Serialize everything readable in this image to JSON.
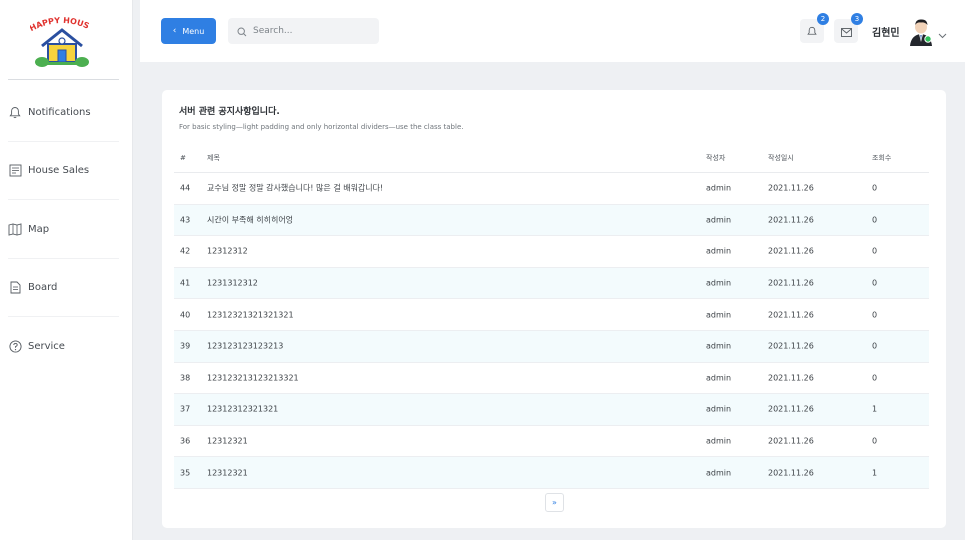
{
  "logo": {
    "text": "HAPPY HOUSE"
  },
  "sidebar": {
    "items": [
      {
        "label": "Notifications",
        "icon": "bell-icon"
      },
      {
        "label": "House Sales",
        "icon": "receipt-icon"
      },
      {
        "label": "Map",
        "icon": "map-icon"
      },
      {
        "label": "Board",
        "icon": "document-icon"
      },
      {
        "label": "Service",
        "icon": "help-circle-icon"
      }
    ]
  },
  "header": {
    "menu_label": "Menu",
    "search_placeholder": "Search...",
    "notifications_count": "2",
    "messages_count": "3",
    "user_name": "김현민"
  },
  "card": {
    "title": "서버 관련 공지사항입니다.",
    "subtitle": "For basic styling—light padding and only horizontal dividers—use the class table."
  },
  "table": {
    "headers": {
      "num": "#",
      "title": "제목",
      "writer": "작성자",
      "date": "작성일시",
      "views": "조회수"
    },
    "rows": [
      {
        "num": "44",
        "title": "교수님 정말 정말 감사했습니다! 많은 걸 배워갑니다!",
        "writer": "admin",
        "date": "2021.11.26",
        "views": "0"
      },
      {
        "num": "43",
        "title": "시간이 부족해 히히히어엉",
        "writer": "admin",
        "date": "2021.11.26",
        "views": "0"
      },
      {
        "num": "42",
        "title": "12312312",
        "writer": "admin",
        "date": "2021.11.26",
        "views": "0"
      },
      {
        "num": "41",
        "title": "1231312312",
        "writer": "admin",
        "date": "2021.11.26",
        "views": "0"
      },
      {
        "num": "40",
        "title": "12312321321321321",
        "writer": "admin",
        "date": "2021.11.26",
        "views": "0"
      },
      {
        "num": "39",
        "title": "123123123123213",
        "writer": "admin",
        "date": "2021.11.26",
        "views": "0"
      },
      {
        "num": "38",
        "title": "123123213123213321",
        "writer": "admin",
        "date": "2021.11.26",
        "views": "0"
      },
      {
        "num": "37",
        "title": "12312312321321",
        "writer": "admin",
        "date": "2021.11.26",
        "views": "1"
      },
      {
        "num": "36",
        "title": "12312321",
        "writer": "admin",
        "date": "2021.11.26",
        "views": "0"
      },
      {
        "num": "35",
        "title": "12312321",
        "writer": "admin",
        "date": "2021.11.26",
        "views": "1"
      }
    ]
  },
  "pagination": {
    "next_label": "»"
  },
  "colors": {
    "accent": "#2f7fe3",
    "stripe": "#f3fbfd",
    "background": "#eef0f3"
  }
}
